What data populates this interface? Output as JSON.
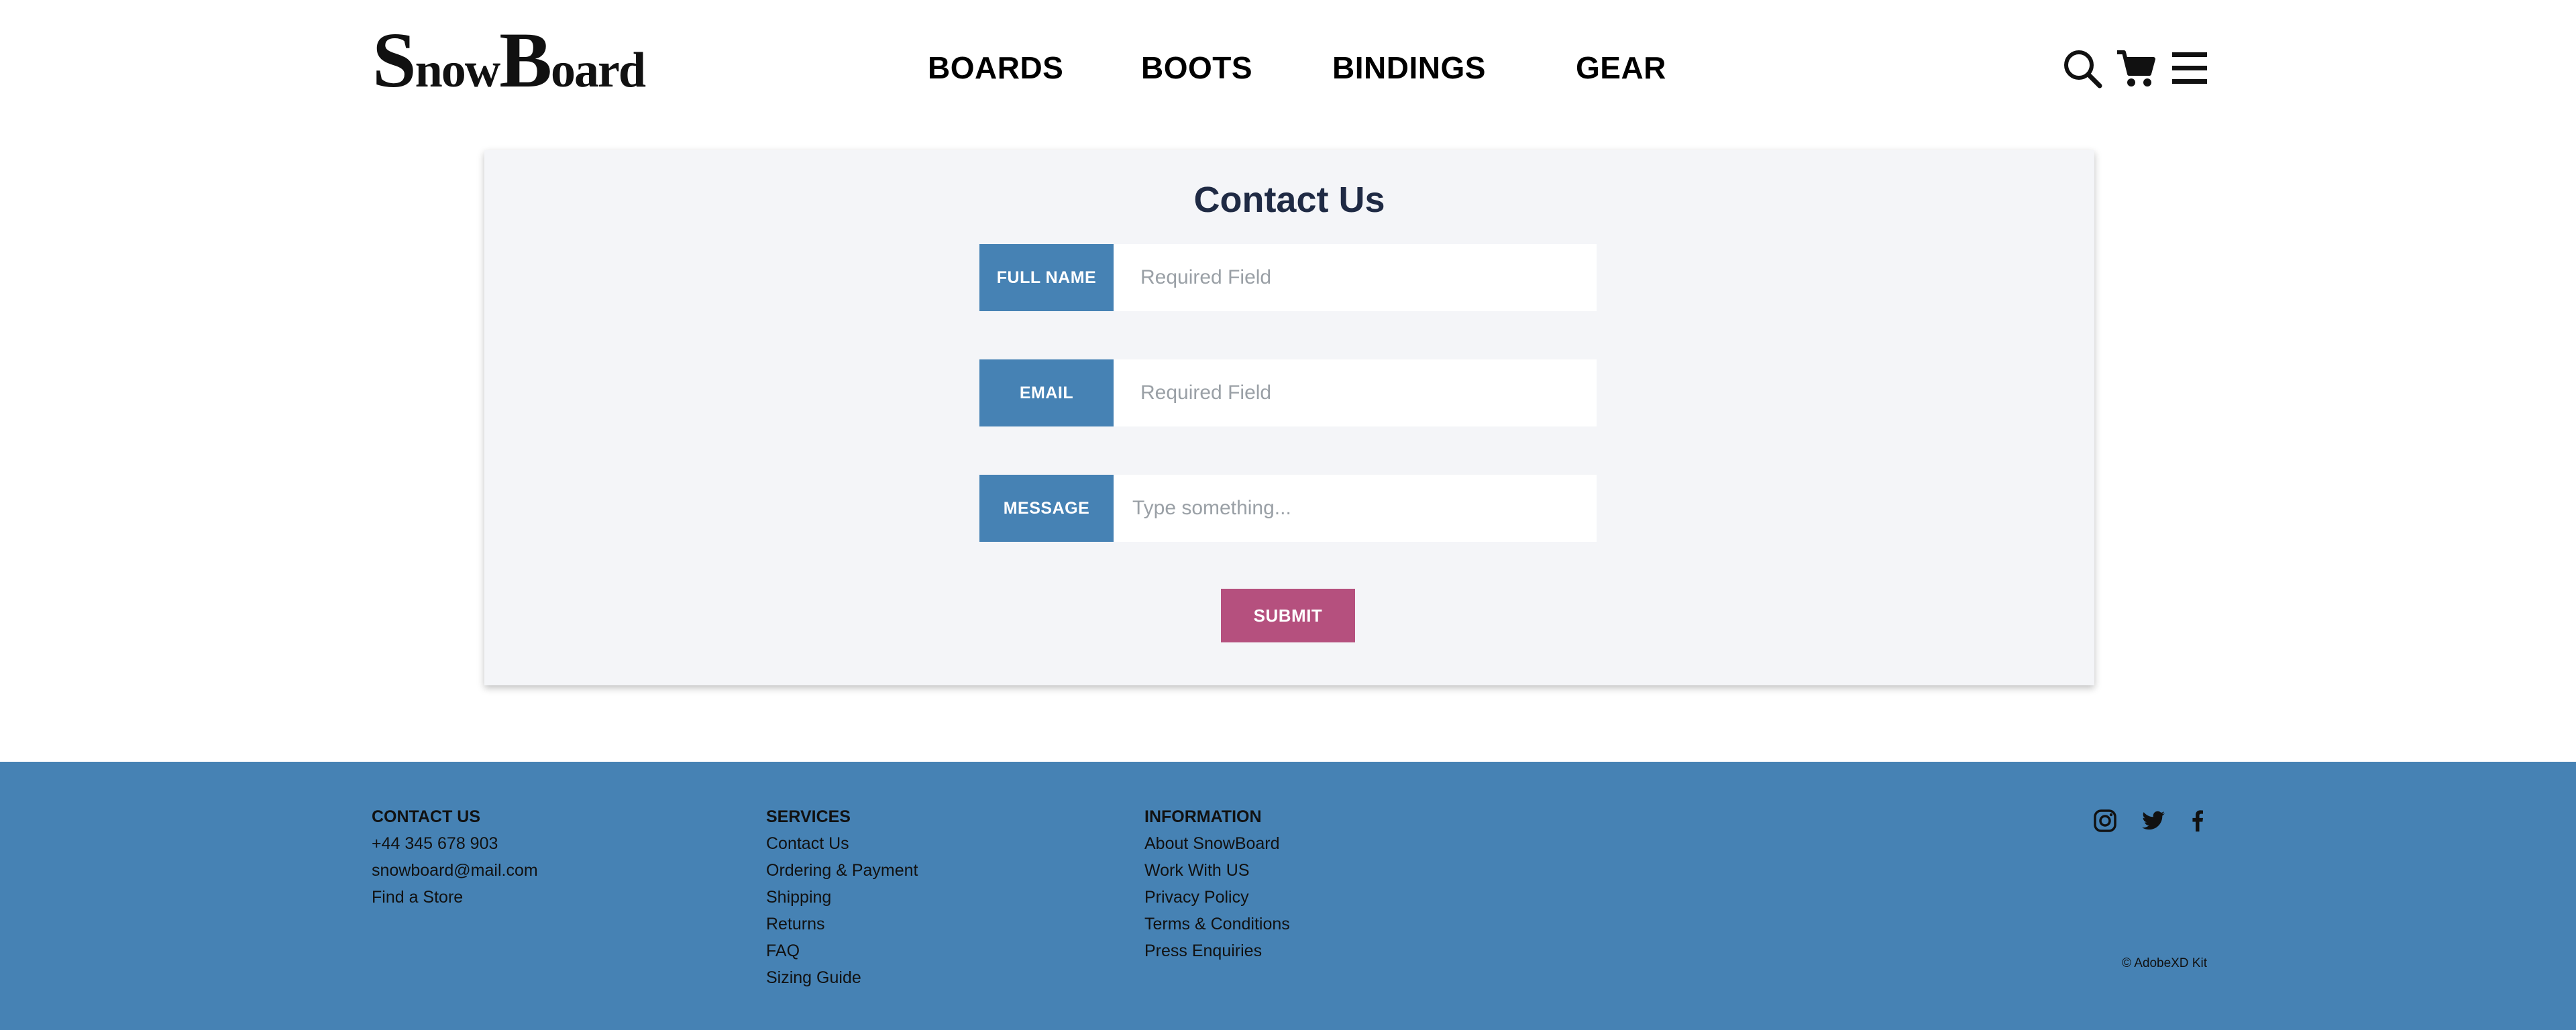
{
  "header": {
    "logo": {
      "part1_big": "S",
      "part1_small": "now",
      "part2_big": "B",
      "part2_small": "oard"
    },
    "nav": [
      {
        "label": "BOARDS"
      },
      {
        "label": "BOOTS"
      },
      {
        "label": "BINDINGS"
      },
      {
        "label": "GEAR"
      }
    ],
    "icons": [
      "search-icon",
      "cart-icon",
      "menu-icon"
    ]
  },
  "contact_form": {
    "title": "Contact Us",
    "fields": [
      {
        "label": "FULL NAME",
        "placeholder": "Required Field",
        "value": ""
      },
      {
        "label": "EMAIL",
        "placeholder": "Required Field",
        "value": ""
      },
      {
        "label": "MESSAGE",
        "placeholder": "Type something...",
        "value": ""
      }
    ],
    "submit_label": "SUBMIT"
  },
  "footer": {
    "contact": {
      "heading": "CONTACT US",
      "items": [
        "+44 345 678 903",
        "snowboard@mail.com",
        "Find a Store"
      ]
    },
    "services": {
      "heading": "SERVICES",
      "items": [
        "Contact Us",
        "Ordering & Payment",
        "Shipping",
        "Returns",
        "FAQ",
        "Sizing Guide"
      ]
    },
    "information": {
      "heading": "INFORMATION",
      "items": [
        "About SnowBoard",
        "Work With US",
        "Privacy Policy",
        "Terms & Conditions",
        "Press Enquiries"
      ]
    },
    "social_icons": [
      "instagram-icon",
      "twitter-icon",
      "facebook-icon"
    ],
    "copyright": "© AdobeXD Kit"
  },
  "colors": {
    "accent_blue": "#4682b4",
    "submit_pink": "#b5507e",
    "card_bg": "#f4f5f8",
    "title_navy": "#1f2a44"
  }
}
